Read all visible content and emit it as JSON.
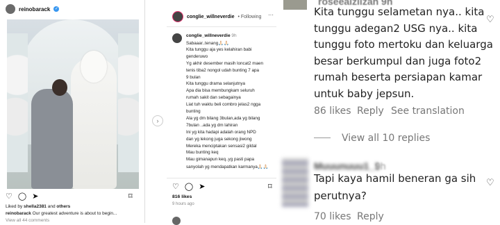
{
  "left_post": {
    "username": "reinobarack",
    "verified_mark": "✓",
    "liked_by_prefix": "Liked by ",
    "liked_by_user": "shella2381",
    "liked_by_and": " and ",
    "liked_by_others": "others",
    "caption_user": "reinobarack",
    "caption_text": " Our greatest adventure is about to begin...",
    "view_comments": "View all 44 comments"
  },
  "mid_post": {
    "username": "conglie_willneverdie",
    "follow_status": "• Following",
    "comment_user": "conglie_willneverdie",
    "comment_time": "9h",
    "comment_lines": [
      "Sabaaar..tenang🙏🏻🙏🏻",
      "Kita tunggu aja yes kelahiran babi",
      "genderuwo",
      "Yg akhir desember masih loncat2 maen",
      "tenis tiba2 nongol udah bunting 7 apa",
      "9 bulan",
      "Kita tunggu drama selanjutnya",
      "Apa dia bisa membungkam seluruh",
      "rumah sakit dan sebagainya",
      "Liat tuh waktu beli combro jelas2 ngga",
      "bunting",
      "Ala yg dm bilang 3bulan,ada yg bilang",
      "7bulan ..ada yg dm lahiran",
      "Ini yg kita hadapi adalah orang NPD",
      "dan yg lekong juga sekong jiwong",
      "Mereka menciptakan sensasi2 gildal",
      "Mau bunting keq",
      "Mau gimanapun keq..yg pasti papa",
      "sanyolah yg mendapatkan karmanya🙏🏻🙏🏻"
    ],
    "likes": "816 likes",
    "time_ago": "9 hours ago"
  },
  "right_comments": {
    "top_name": "roseeaiziizah",
    "top_time": "9h",
    "comment1_lines": [
      "Kita tunggu selametan nya.. kita",
      "tunggu adegan2 USG nya.. kita",
      "tunggu foto mertoku dan keluarga",
      "besar berkumpul dan juga foto2",
      "rumah beserta persiapan kamar",
      "untuk baby jepsun."
    ],
    "comment1_likes": "86 likes",
    "comment1_reply": "Reply",
    "comment1_translation": "See translation",
    "view_replies": "View all 10 replies",
    "comment2_name": "Muuunuuu1_1",
    "comment2_time": "9h",
    "comment2_lines": [
      "Tapi kaya hamil beneran ga sih",
      "perutnya?"
    ],
    "comment2_likes": "70 likes",
    "comment2_reply": "Reply"
  },
  "icons": {
    "heart": "♡",
    "comment": "◯",
    "share": "➤",
    "bookmark": "⌑",
    "more": "···",
    "next": "›"
  }
}
